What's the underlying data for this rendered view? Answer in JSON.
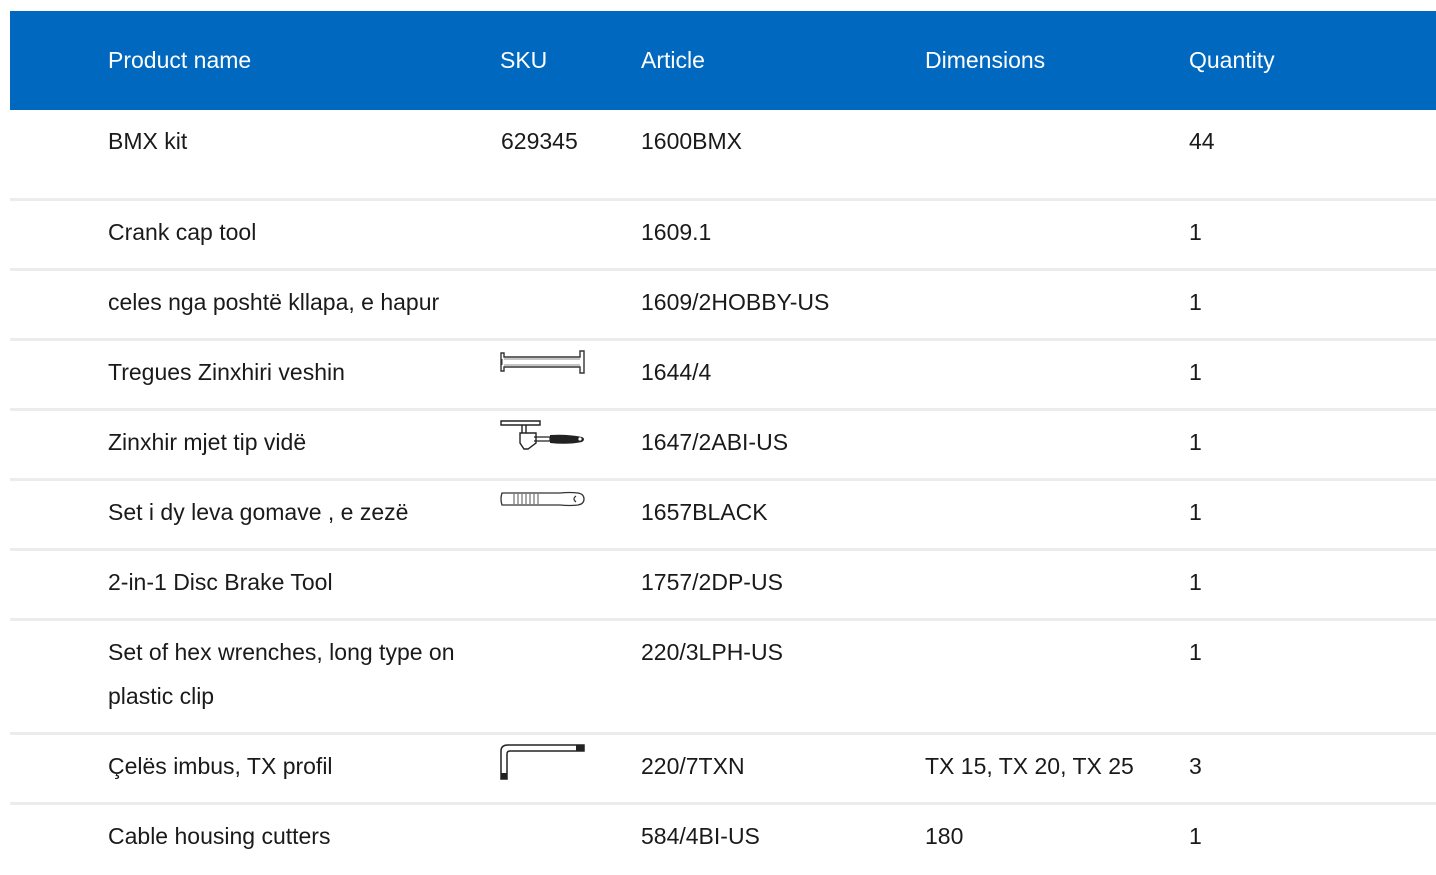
{
  "headers": {
    "name": "Product name",
    "sku": "SKU",
    "article": "Article",
    "dimensions": "Dimensions",
    "quantity": "Quantity"
  },
  "rows": [
    {
      "name": "BMX kit",
      "sku": "629345",
      "sku_icon": "",
      "article": "1600BMX",
      "dimensions": "",
      "quantity": "44"
    },
    {
      "name": "Crank cap tool",
      "sku": "",
      "sku_icon": "",
      "article": "1609.1",
      "dimensions": "",
      "quantity": "1"
    },
    {
      "name": "celes nga poshtë kllapa, e hapur",
      "sku": "",
      "sku_icon": "",
      "article": "1609/2HOBBY-US",
      "dimensions": "",
      "quantity": "1"
    },
    {
      "name": "Tregues Zinxhiri veshin",
      "sku": "",
      "sku_icon": "chain-wear-gauge-icon",
      "article": "1644/4",
      "dimensions": "",
      "quantity": "1"
    },
    {
      "name": "Zinxhir mjet tip vidë",
      "sku": "",
      "sku_icon": "chain-tool-icon",
      "article": "1647/2ABI-US",
      "dimensions": "",
      "quantity": "1"
    },
    {
      "name": "Set i dy leva gomave , e zezë",
      "sku": "",
      "sku_icon": "tire-lever-icon",
      "article": "1657BLACK",
      "dimensions": "",
      "quantity": "1"
    },
    {
      "name": "2-in-1 Disc Brake Tool",
      "sku": "",
      "sku_icon": "",
      "article": "1757/2DP-US",
      "dimensions": "",
      "quantity": "1"
    },
    {
      "name": "Set of hex wrenches, long type on plastic clip",
      "sku": "",
      "sku_icon": "",
      "article": "220/3LPH-US",
      "dimensions": "",
      "quantity": "1"
    },
    {
      "name": "Çelës imbus, TX profil",
      "sku": "",
      "sku_icon": "torx-key-icon",
      "article": "220/7TXN",
      "dimensions": "TX 15, TX 20, TX 25",
      "quantity": "3"
    },
    {
      "name": "Cable housing cutters",
      "sku": "",
      "sku_icon": "",
      "article": "584/4BI-US",
      "dimensions": "180",
      "quantity": "1"
    }
  ]
}
